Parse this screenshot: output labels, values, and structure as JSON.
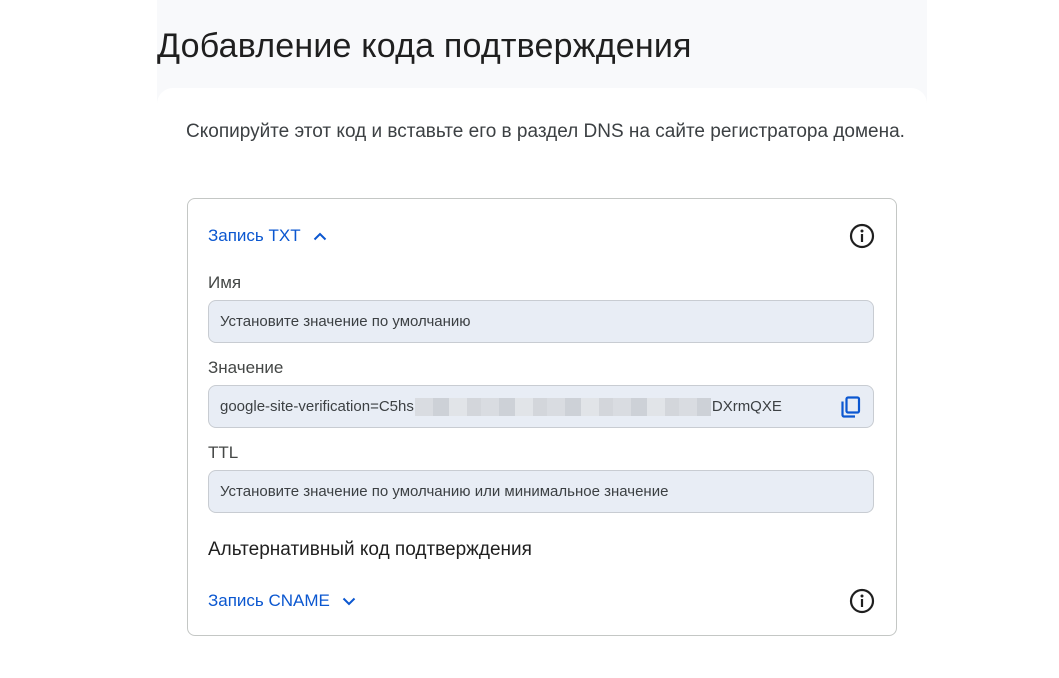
{
  "page": {
    "title": "Добавление кода подтверждения"
  },
  "card": {
    "instructions": "Скопируйте этот код и вставьте его в раздел DNS на сайте регистратора домена."
  },
  "txt_record": {
    "header_label": "Запись TXT",
    "expanded": true,
    "fields": {
      "name": {
        "label": "Имя",
        "value": "Установите значение по умолчанию"
      },
      "value": {
        "label": "Значение",
        "value_start": "google-site-verification=C5hs",
        "value_end": "DXrmQXE"
      },
      "ttl": {
        "label": "TTL",
        "value": "Установите значение по умолчанию или минимальное значение"
      }
    }
  },
  "alternative": {
    "heading": "Альтернативный код подтверждения"
  },
  "cname_record": {
    "header_label": "Запись CNAME",
    "expanded": false
  },
  "icons": {
    "expand_less": "chevron-up-icon",
    "expand_more": "chevron-down-icon",
    "info": "info-icon",
    "copy": "copy-icon"
  },
  "colors": {
    "accent": "#0b57d0",
    "field_background": "#e8edf5",
    "page_background": "#f8f9fb",
    "text_primary": "#1f1f1f",
    "text_secondary": "#444746"
  }
}
